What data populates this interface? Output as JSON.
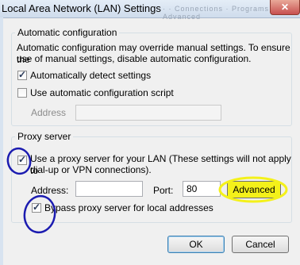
{
  "window": {
    "title": "Local Area Network (LAN) Settings",
    "tabs_ghost": "· ·  Connections  · Programs  ·  Advanced",
    "close_glyph": "✕"
  },
  "auto_config": {
    "legend": "Automatic configuration",
    "description_line1": "Automatic configuration may override manual settings.  To ensure the",
    "description_line2": "use of manual settings, disable automatic configuration.",
    "auto_detect": {
      "label": "Automatically detect settings",
      "checked": true
    },
    "use_script": {
      "label": "Use automatic configuration script",
      "checked": false
    },
    "address_label": "Address",
    "address_value": ""
  },
  "proxy": {
    "legend": "Proxy server",
    "use_proxy": {
      "label_line1": "Use a proxy server for your LAN (These settings will not apply to",
      "label_line2": "dial-up or VPN connections).",
      "checked": true
    },
    "address_label": "Address:",
    "address_value": "",
    "port_label": "Port:",
    "port_value": "80",
    "advanced_label": "Advanced",
    "bypass": {
      "label": "Bypass proxy server for local addresses",
      "checked": true
    }
  },
  "buttons": {
    "ok": "OK",
    "cancel": "Cancel"
  },
  "colors": {
    "highlight": "#f4f11a",
    "annotation": "#1b1bb0"
  }
}
